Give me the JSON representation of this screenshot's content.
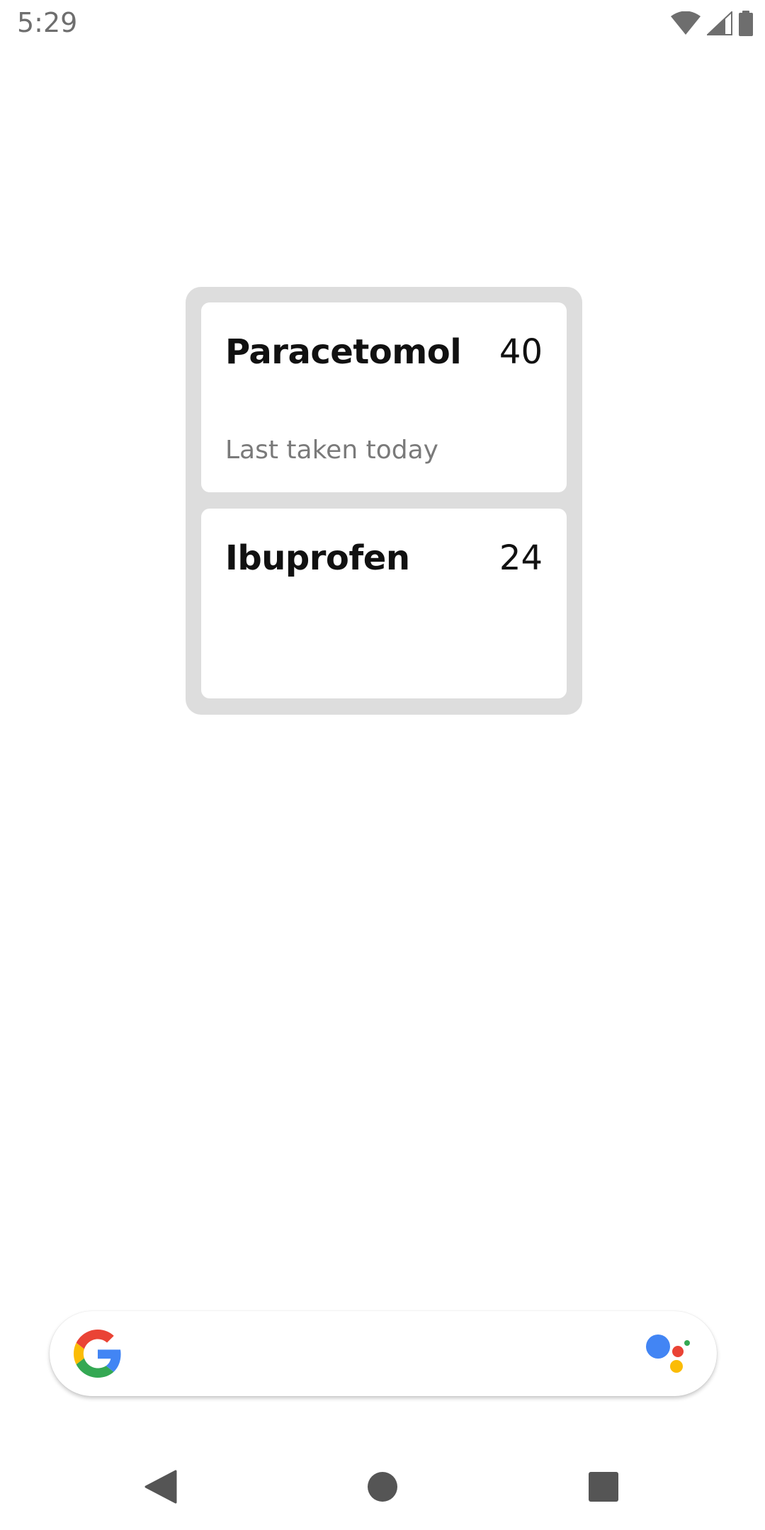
{
  "status_bar": {
    "time": "5:29",
    "icons": [
      "wifi-icon",
      "cell-signal-icon",
      "battery-icon"
    ]
  },
  "widget": {
    "medications": [
      {
        "name": "Paracetomol",
        "count": "40",
        "last_taken": "Last taken today"
      },
      {
        "name": "Ibuprofen",
        "count": "24",
        "last_taken": ""
      }
    ]
  },
  "search_bar": {
    "left_icon": "google-logo-icon",
    "right_icon": "google-assistant-icon"
  },
  "nav_bar": {
    "buttons": [
      "back-icon",
      "home-icon",
      "recents-icon"
    ]
  },
  "colors": {
    "widget_background": "#dddddd",
    "card_background": "#ffffff",
    "secondary_text": "#7a7a7a",
    "google_blue": "#4285F4",
    "google_red": "#EA4335",
    "google_yellow": "#FBBC05",
    "google_green": "#34A853"
  }
}
